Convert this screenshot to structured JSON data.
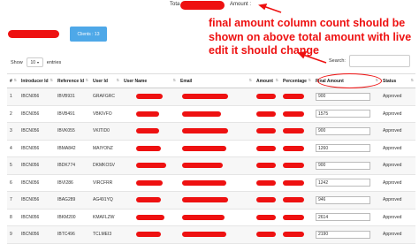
{
  "header": {
    "total_label": "Tota",
    "amount_label": "Amount :"
  },
  "annotation": {
    "text": "final amount column count should be shown on above total amount with live edit it should change"
  },
  "clients_button": {
    "label": "Clients : 13"
  },
  "length_menu": {
    "show_label": "Show",
    "selected": "10",
    "entries_label": "entries"
  },
  "search": {
    "label": "Search:",
    "value": ""
  },
  "table": {
    "columns": [
      "#",
      "Introducer Id",
      "Reference Id",
      "User Id",
      "User Name",
      "Email",
      "Amount",
      "Percentage",
      "Final Amount",
      "Status"
    ],
    "rows": [
      {
        "num": "1",
        "introducer": "IBCN056",
        "reference": "IBVB931",
        "user": "GRAFGRC",
        "final_amount": "900",
        "status": "Approved"
      },
      {
        "num": "2",
        "introducer": "IBCN056",
        "reference": "IBVB491",
        "user": "VBKIVFO",
        "final_amount": "1575",
        "status": "Approved"
      },
      {
        "num": "3",
        "introducer": "IBCN056",
        "reference": "IBVK055",
        "user": "VKITID0",
        "final_amount": "900",
        "status": "Approved"
      },
      {
        "num": "4",
        "introducer": "IBCN056",
        "reference": "IBMA842",
        "user": "MAIYONZ",
        "final_amount": "1260",
        "status": "Approved"
      },
      {
        "num": "5",
        "introducer": "IBCN056",
        "reference": "IBDK774",
        "user": "DKMKOSV",
        "final_amount": "900",
        "status": "Approved"
      },
      {
        "num": "6",
        "introducer": "IBCN056",
        "reference": "IBVI286",
        "user": "VIRCFRR",
        "final_amount": "1242",
        "status": "Approved"
      },
      {
        "num": "7",
        "introducer": "IBCN056",
        "reference": "IBAG289",
        "user": "AG491YQ",
        "final_amount": "946",
        "status": "Approved"
      },
      {
        "num": "8",
        "introducer": "IBCN056",
        "reference": "IBKM200",
        "user": "KMAFLZW",
        "final_amount": "2614",
        "status": "Approved"
      },
      {
        "num": "9",
        "introducer": "IBCN056",
        "reference": "IBTC496",
        "user": "TCLMEI3",
        "final_amount": "2190",
        "status": "Approved"
      }
    ]
  },
  "colors": {
    "annotation_red": "#ee1111",
    "clients_button_bg": "#4ea8e8"
  },
  "icons": {
    "sort": "sort-arrows-icon"
  }
}
